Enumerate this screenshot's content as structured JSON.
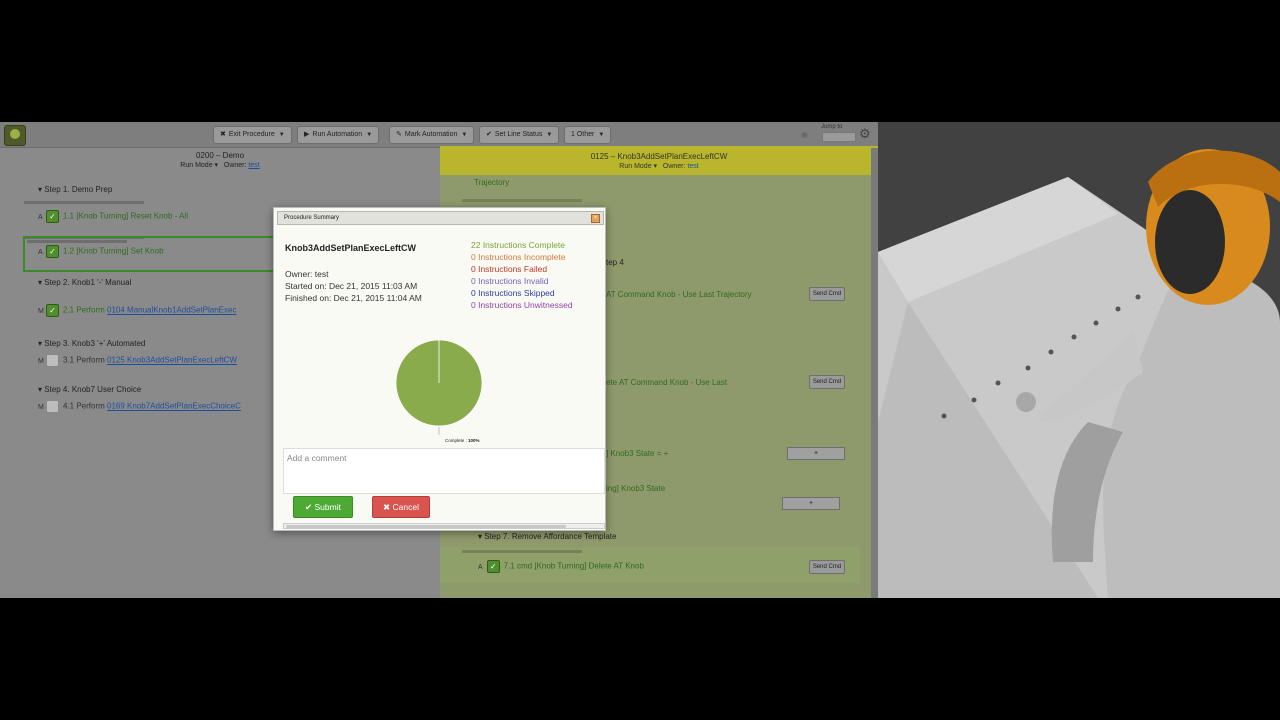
{
  "toolbar": {
    "exit_procedure": "Exit Procedure",
    "run_automation": "Run Automation",
    "mark_automation": "Mark Automation",
    "set_line_status": "Set Line Status",
    "other": "1 Other",
    "search_label": "Jump to"
  },
  "left_procedure": {
    "title": "0200 – Demo",
    "run_mode": "Run Mode",
    "owner_label": "Owner:",
    "owner": "test",
    "steps": [
      {
        "label": "Step 1. Demo Prep"
      },
      {
        "label": "Step 2. Knob1 '-' Manual"
      },
      {
        "label": "Step 3. Knob3 '+' Automated"
      },
      {
        "label": "Step 4. Knob7 User Choice"
      }
    ],
    "rows": [
      {
        "mode": "A",
        "text": "1.1 [Knob Turning] Reset Knob - All",
        "link": ""
      },
      {
        "mode": "A",
        "text": "1.2 [Knob Turning] Set Knob",
        "link": ""
      },
      {
        "mode": "M",
        "text": "2.1 Perform ",
        "link": "0104 ManualKnob1AddSetPlanExec"
      },
      {
        "mode": "M",
        "text": "3.1 Perform ",
        "link": "0125 Knob3AddSetPlanExecLeftCW"
      },
      {
        "mode": "M",
        "text": "4.1 Perform ",
        "link": "0169 Knob7AddSetPlanExecChoiceC"
      }
    ]
  },
  "right_procedure": {
    "title": "0125 – Knob3AddSetPlanExecLeftCW",
    "run_mode": "Run Mode",
    "owner_label": "Owner:",
    "owner": "test",
    "rows": {
      "trajectory": "Trajectory",
      "step4": "tep 4",
      "cmd1": "AT Command Knob - Use Last Trajectory",
      "cmd2": "ete AT Command Knob - Use Last",
      "state1": "] Knob3 State = +",
      "state2": "ing] Knob3 State",
      "step7": "Step 7. Remove Affordance Template",
      "row71": "7.1 cmd [Knob Turning] Delete AT Knob"
    },
    "send_cmd": "Send Cmd",
    "plus": "+"
  },
  "modal": {
    "title": "Procedure Summary",
    "procedure_name": "Knob3AddSetPlanExecLeftCW",
    "owner": "Owner: test",
    "started": "Started on: Dec 21, 2015 11:03 AM",
    "finished": "Finished on: Dec 21, 2015 11:04 AM",
    "stats": {
      "complete": "22 Instructions Complete",
      "incomplete": "0 Instructions Incomplete",
      "failed": "0 Instructions Failed",
      "invalid": "0 Instructions Invalid",
      "skipped": "0 Instructions Skipped",
      "unwitnessed": "0 Instructions Unwitnessed"
    },
    "comment_placeholder": "Add a comment",
    "submit": "Submit",
    "cancel": "Cancel",
    "colors": {
      "complete": "#8aab4b",
      "submit": "#4caa34",
      "cancel": "#d9534f"
    }
  },
  "chart_data": {
    "type": "pie",
    "slices": [
      {
        "label": "Complete",
        "value": 100,
        "display": "100%"
      }
    ],
    "data_label": "Complete : 100%"
  }
}
